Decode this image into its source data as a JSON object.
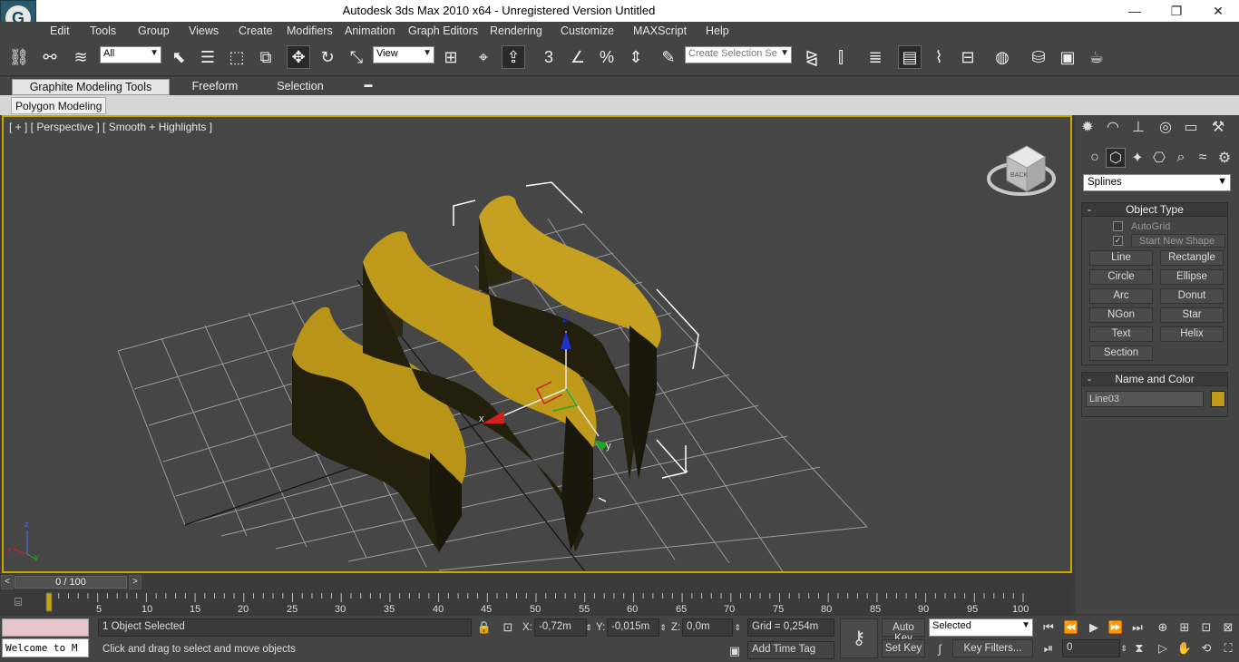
{
  "window": {
    "title": "Autodesk 3ds Max  2010 x64   -  Unregistered Version      Untitled",
    "minimize": "—",
    "restore": "❐",
    "close": "✕",
    "logo_letter": "G"
  },
  "menu": [
    "Edit",
    "Tools",
    "Group",
    "Views",
    "Create",
    "Modifiers",
    "Animation",
    "Graph Editors",
    "Rendering",
    "Customize",
    "MAXScript",
    "Help"
  ],
  "toolbar": {
    "filter_value": "All",
    "refcoord_value": "View",
    "selection_set_placeholder": "Create Selection Se",
    "snap_label": "3",
    "percent_label": "%"
  },
  "ribbon": {
    "tabs": [
      "Graphite Modeling Tools",
      "Freeform",
      "Selection"
    ],
    "active_tab": "Graphite Modeling Tools",
    "subtab": "Polygon Modeling"
  },
  "viewport": {
    "label": "[ + ] [ Perspective ] [ Smooth + Highlights ]",
    "viewcube_face": "BACK",
    "axis_x": "x",
    "axis_y": "y",
    "axis_z": "z"
  },
  "command_panel": {
    "category_dropdown": "Splines",
    "object_type": {
      "title": "Object Type",
      "autogrid_label": "AutoGrid",
      "autogrid_checked": false,
      "start_new_shape_label": "Start New Shape",
      "start_new_shape_checked": true,
      "buttons": [
        "Line",
        "Rectangle",
        "Circle",
        "Ellipse",
        "Arc",
        "Donut",
        "NGon",
        "Star",
        "Text",
        "Helix",
        "Section"
      ]
    },
    "name_and_color": {
      "title": "Name and Color",
      "name_value": "Line03",
      "color": "#c09a1a"
    }
  },
  "timeline": {
    "frame_display": "0 / 100",
    "prev": "<",
    "next": ">",
    "ticks": [
      "0",
      "5",
      "10",
      "15",
      "20",
      "25",
      "30",
      "35",
      "40",
      "45",
      "50",
      "55",
      "60",
      "65",
      "70",
      "75",
      "80",
      "85",
      "90",
      "95",
      "100"
    ]
  },
  "status": {
    "maxscript_listener": "Welcome to M",
    "selection_count": "1 Object Selected",
    "prompt": "Click and drag to select and move objects",
    "x_label": "X:",
    "x_value": "-0,72m",
    "y_label": "Y:",
    "y_value": "-0,015m",
    "z_label": "Z:",
    "z_value": "0,0m",
    "grid": "Grid = 0,254m",
    "add_time_tag": "Add Time Tag",
    "auto_key": "Auto Key",
    "set_key": "Set Key",
    "selected_dropdown": "Selected",
    "key_filters": "Key Filters...",
    "current_frame": "0"
  },
  "colors": {
    "background": "#3c3c3c",
    "viewport_bg": "#464646",
    "viewport_border": "#c8a800",
    "object_top": "#c09a1a",
    "object_side": "#2c2810"
  }
}
